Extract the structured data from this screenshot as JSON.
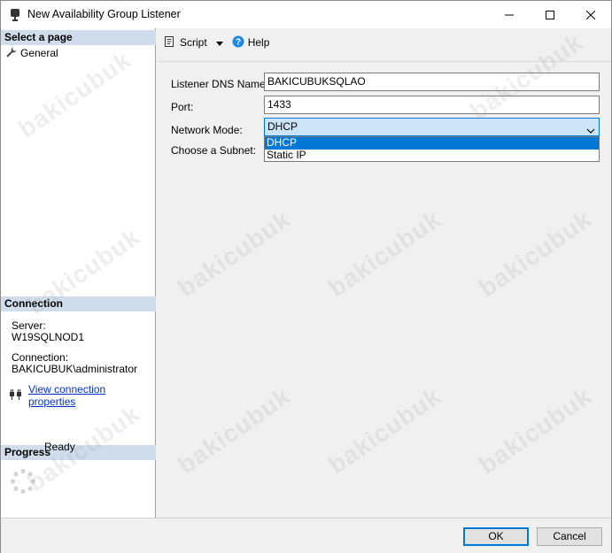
{
  "window": {
    "title": "New Availability Group Listener",
    "icon": "database-icon"
  },
  "left": {
    "select_page_header": "Select a page",
    "pages": [
      {
        "label": "General",
        "icon": "wrench-icon"
      }
    ],
    "connection_header": "Connection",
    "server_label": "Server:",
    "server_value": "W19SQLNOD1",
    "connection_label": "Connection:",
    "connection_value": "BAKICUBUK\\administrator",
    "view_properties_link": "View connection properties",
    "progress_header": "Progress",
    "progress_status": "Ready"
  },
  "toolbar": {
    "script_label": "Script",
    "help_label": "Help"
  },
  "form": {
    "dns_label": "Listener DNS Name:",
    "dns_value": "BAKICUBUKSQLAO",
    "port_label": "Port:",
    "port_value": "1433",
    "mode_label": "Network Mode:",
    "mode_value": "DHCP",
    "mode_options": [
      "DHCP",
      "Static IP"
    ],
    "subnet_label": "Choose a Subnet:"
  },
  "buttons": {
    "ok_label": "OK",
    "cancel_label": "Cancel"
  },
  "watermark": "bakicubuk",
  "colors": {
    "section_header_bg": "#cfdceb",
    "accent": "#0078d7",
    "link": "#0033cc"
  }
}
